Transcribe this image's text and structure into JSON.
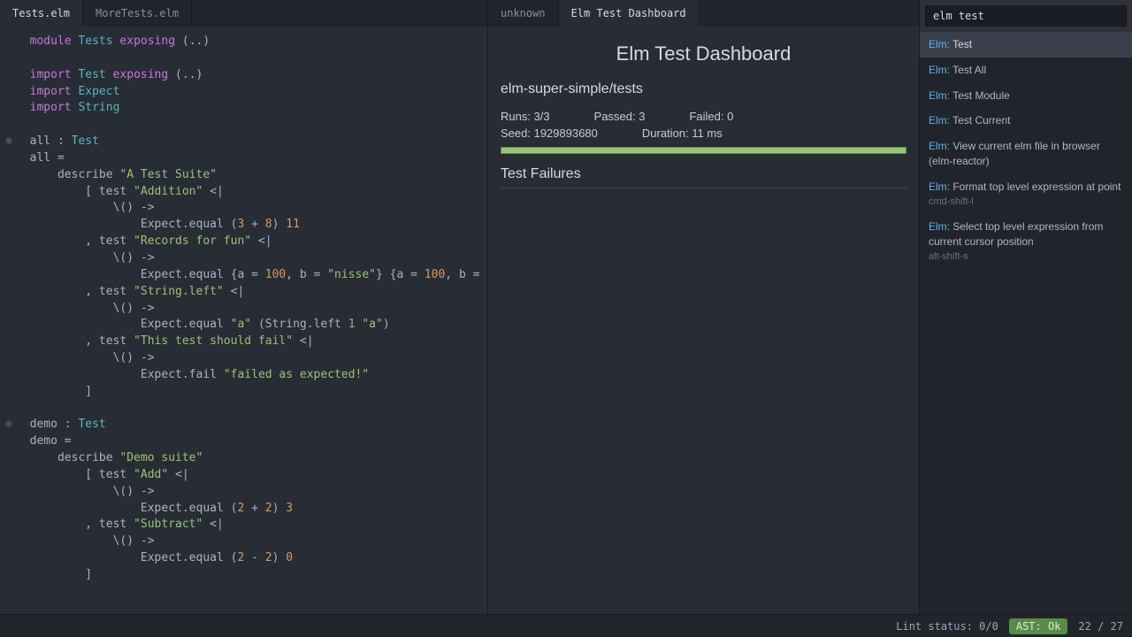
{
  "tabs": {
    "left": [
      {
        "label": "Tests.elm",
        "active": true
      },
      {
        "label": "MoreTests.elm",
        "active": false
      }
    ],
    "center": [
      {
        "label": "unknown",
        "active": false
      },
      {
        "label": "Elm Test Dashboard",
        "active": true
      }
    ]
  },
  "code": {
    "l1": "module",
    "l1b": "Tests",
    "l1c": "exposing",
    "l1d": "(..)",
    "l2": "import",
    "l2b": "Test",
    "l2c": "exposing",
    "l2d": "(..)",
    "l3": "import",
    "l3b": "Expect",
    "l4": "import",
    "l4b": "String",
    "l5a": "all : ",
    "l5b": "Test",
    "l6": "all =",
    "l7a": "    describe ",
    "l7b": "\"A Test Suite\"",
    "l8a": "        [ test ",
    "l8b": "\"Addition\"",
    "l8c": " <|",
    "l9": "            \\() ->",
    "l10a": "                Expect.equal (",
    "l10b": "3",
    "l10c": " + ",
    "l10d": "8",
    "l10e": ") ",
    "l10f": "11",
    "l11a": "        , test ",
    "l11b": "\"Records for fun\"",
    "l11c": " <|",
    "l12": "            \\() ->",
    "l13a": "                Expect.equal {a = ",
    "l13b": "100",
    "l13c": ", b = ",
    "l13d": "\"nisse\"",
    "l13e": "} {a = ",
    "l13f": "100",
    "l13g": ", b = ",
    "l13h": "\"nisse\"",
    "l13i": "}",
    "l14a": "        , test ",
    "l14b": "\"String.left\"",
    "l14c": " <|",
    "l15": "            \\() ->",
    "l16a": "                Expect.equal ",
    "l16b": "\"a\"",
    "l16c": " (String.left ",
    "l16d": "1",
    "l16e": " ",
    "l16f": "\"a\"",
    "l16g": ")",
    "l17a": "        , test ",
    "l17b": "\"This test should fail\"",
    "l17c": " <|",
    "l18": "            \\() ->",
    "l19a": "                Expect.fail ",
    "l19b": "\"failed as expected!\"",
    "l20": "        ]",
    "l21a": "demo : ",
    "l21b": "Test",
    "l22": "demo =",
    "l23a": "    describe ",
    "l23b": "\"Demo suite\"",
    "l24a": "        [ test ",
    "l24b": "\"Add\"",
    "l24c": " <|",
    "l25": "            \\() ->",
    "l26a": "                Expect.equal (",
    "l26b": "2",
    "l26c": " + ",
    "l26d": "2",
    "l26e": ") ",
    "l26f": "3",
    "l27a": "        , test ",
    "l27b": "\"Subtract\"",
    "l27c": " <|",
    "l28": "            \\() ->",
    "l29a": "                Expect.equal (",
    "l29b": "2",
    "l29c": " - ",
    "l29d": "2",
    "l29e": ") ",
    "l29f": "0",
    "l30": "        ]"
  },
  "dashboard": {
    "title": "Elm Test Dashboard",
    "path": "elm-super-simple/tests",
    "runs_label": "Runs: 3/3",
    "passed_label": "Passed: 3",
    "failed_label": "Failed: 0",
    "seed_label": "Seed: 1929893680",
    "duration_label": "Duration: 11 ms",
    "failures_heading": "Test Failures"
  },
  "palette": {
    "query": "elm test",
    "items": [
      {
        "prefix": "Elm:",
        "label": "Test",
        "shortcut": ""
      },
      {
        "prefix": "Elm:",
        "label": "Test All",
        "shortcut": ""
      },
      {
        "prefix": "Elm:",
        "label": "Test Module",
        "shortcut": ""
      },
      {
        "prefix": "Elm:",
        "label": "Test Current",
        "shortcut": ""
      },
      {
        "prefix": "Elm:",
        "label": "View current elm file in browser (elm-reactor)",
        "shortcut": ""
      },
      {
        "prefix": "Elm:",
        "label": "Format top level expression at point",
        "shortcut": "cmd-shift-l"
      },
      {
        "prefix": "Elm:",
        "label": "Select top level expression from current cursor position",
        "shortcut": "alt-shift-s"
      }
    ]
  },
  "status": {
    "lint": "Lint status: 0/0",
    "ast": "AST: Ok",
    "position": "22 / 27"
  }
}
